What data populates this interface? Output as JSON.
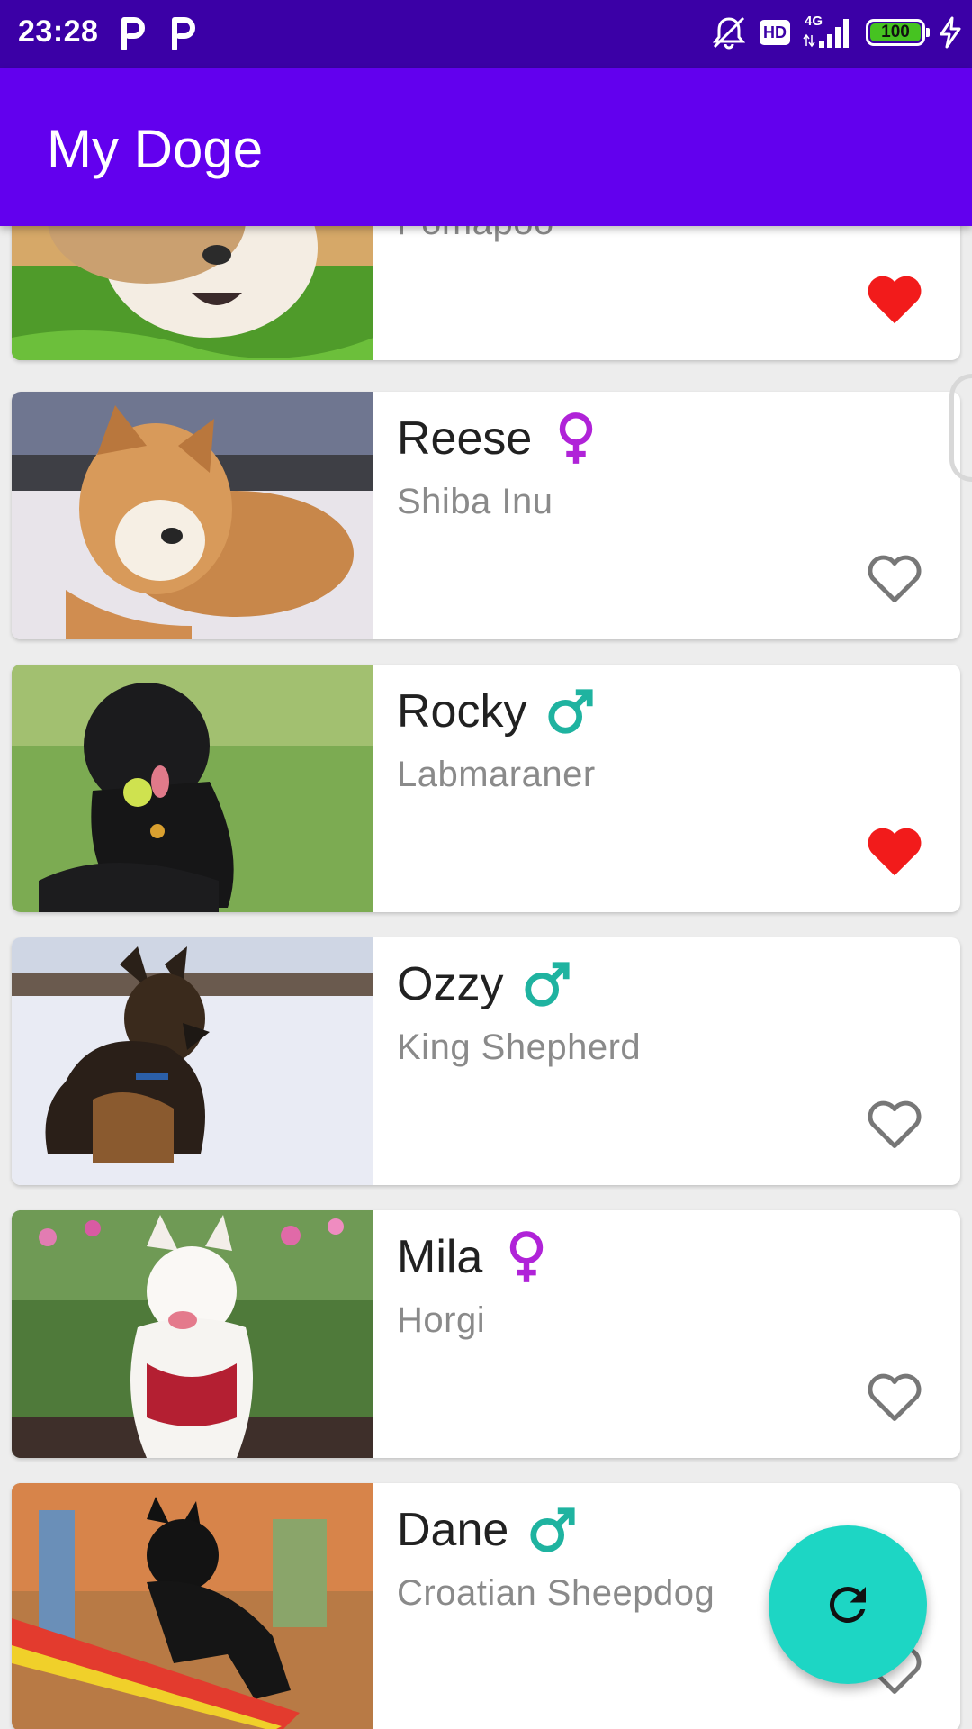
{
  "status_bar": {
    "time": "23:28",
    "notification_icons": [
      "parking-p-icon",
      "parking-p-icon"
    ],
    "right_icons": [
      "bell-off-icon",
      "hd-icon",
      "signal-4g-icon",
      "battery-icon",
      "charging-icon"
    ],
    "hd_label": "HD",
    "network_label": "4G",
    "battery": "100"
  },
  "app_bar": {
    "title": "My Doge"
  },
  "colors": {
    "app_bar": "#6200ee",
    "status_bar": "#3b00a6",
    "fab": "#1dd6c4",
    "favorite": "#f21b1b",
    "female": "#b023d8",
    "male": "#1fb3a0"
  },
  "dogs": [
    {
      "name": "",
      "breed": "Pomapoo",
      "gender": "",
      "favorite": true
    },
    {
      "name": "Reese",
      "breed": "Shiba Inu",
      "gender": "female",
      "favorite": false
    },
    {
      "name": "Rocky",
      "breed": "Labmaraner",
      "gender": "male",
      "favorite": true
    },
    {
      "name": "Ozzy",
      "breed": "King Shepherd",
      "gender": "male",
      "favorite": false
    },
    {
      "name": "Mila",
      "breed": "Horgi",
      "gender": "female",
      "favorite": false
    },
    {
      "name": "Dane",
      "breed": "Croatian Sheepdog",
      "gender": "male",
      "favorite": false
    }
  ],
  "fab": {
    "icon": "refresh-icon"
  }
}
